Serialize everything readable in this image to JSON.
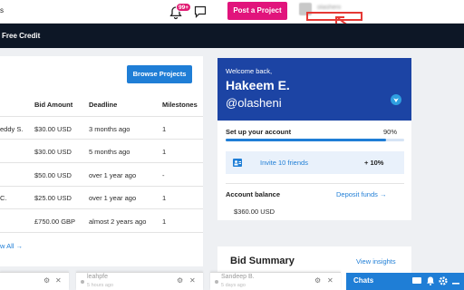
{
  "header": {
    "crumb": "s",
    "notification_count": "99+",
    "post_project_label": "Post a Project",
    "blurred_username": "olasheni"
  },
  "navbar": {
    "free_credit": "Free Credit"
  },
  "projects": {
    "browse_label": "Browse Projects",
    "columns": [
      "Bid Amount",
      "Deadline",
      "Milestones"
    ],
    "rows": [
      {
        "name": "eddy S.",
        "bid": "$30.00 USD",
        "deadline": "3 months ago",
        "milestones": "1"
      },
      {
        "name": "",
        "bid": "$30.00 USD",
        "deadline": "5 months ago",
        "milestones": "1"
      },
      {
        "name": "",
        "bid": "$50.00 USD",
        "deadline": "over 1 year ago",
        "milestones": "-"
      },
      {
        "name": "C.",
        "bid": "$25.00 USD",
        "deadline": "over 1 year ago",
        "milestones": "1"
      },
      {
        "name": "",
        "bid": "£750.00 GBP",
        "deadline": "almost 2 years ago",
        "milestones": "1"
      }
    ],
    "view_all": "w All →"
  },
  "welcome": {
    "greeting": "Welcome back,",
    "name": "Hakeem E.",
    "handle": "@olasheni"
  },
  "setup": {
    "label": "Set up your account",
    "percent_text": "90%",
    "progress": 0.9,
    "invite_label": "Invite 10 friends",
    "invite_bonus": "+ 10%",
    "balance_label": "Account balance",
    "deposit_label": "Deposit funds →",
    "balance_value": "$360.00 USD"
  },
  "bid_summary": {
    "title": "Bid Summary",
    "view_insights": "View insights"
  },
  "chat_tabs": [
    {
      "name": "",
      "ago": ""
    },
    {
      "name": "leahpfe",
      "ago": "5 hours ago"
    },
    {
      "name": "Sandeep B.",
      "ago": "5 days ago"
    }
  ],
  "chats": {
    "label": "Chats"
  },
  "colors": {
    "brand_pink": "#e1147c",
    "brand_blue": "#1f7ed6",
    "navbar": "#0d1726",
    "welcome_bg": "#1c44a4",
    "highlight_red": "#e53935"
  },
  "icons": [
    "bell-icon",
    "message-icon",
    "verified-icon",
    "invite-icon",
    "gear-icon",
    "close-icon",
    "bell-icon",
    "minimize-icon"
  ]
}
